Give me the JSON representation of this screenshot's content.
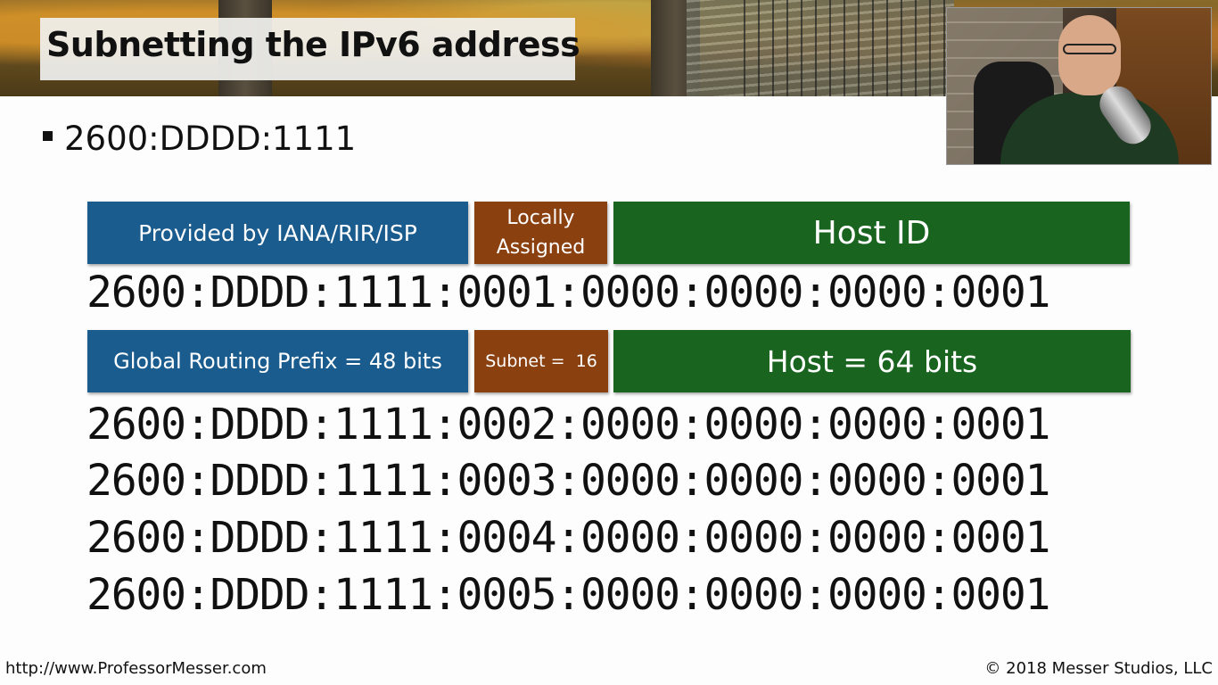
{
  "slide": {
    "title": "Subnetting the IPv6 address",
    "bullet": "2600:DDDD:1111"
  },
  "row1": {
    "provided": "Provided by IANA/RIR/ISP",
    "locally_line1": "Locally",
    "locally_line2": "Assigned",
    "host_id": "Host ID"
  },
  "address_main": "2600:DDDD:1111:0001:0000:0000:0000:0001",
  "row2": {
    "prefix": "Global Routing Prefix = 48 bits",
    "subnet": "Subnet =  16",
    "host": "Host = 64 bits"
  },
  "addresses": [
    "2600:DDDD:1111:0002:0000:0000:0000:0001",
    "2600:DDDD:1111:0003:0000:0000:0000:0001",
    "2600:DDDD:1111:0004:0000:0000:0000:0001",
    "2600:DDDD:1111:0005:0000:0000:0000:0001"
  ],
  "footer": {
    "url": "http://www.ProfessorMesser.com",
    "copyright": "© 2018 Messer Studios, LLC"
  },
  "colors": {
    "blue_box": "#1b5c8e",
    "brown_box": "#8b4010",
    "green_box": "#19641f"
  }
}
